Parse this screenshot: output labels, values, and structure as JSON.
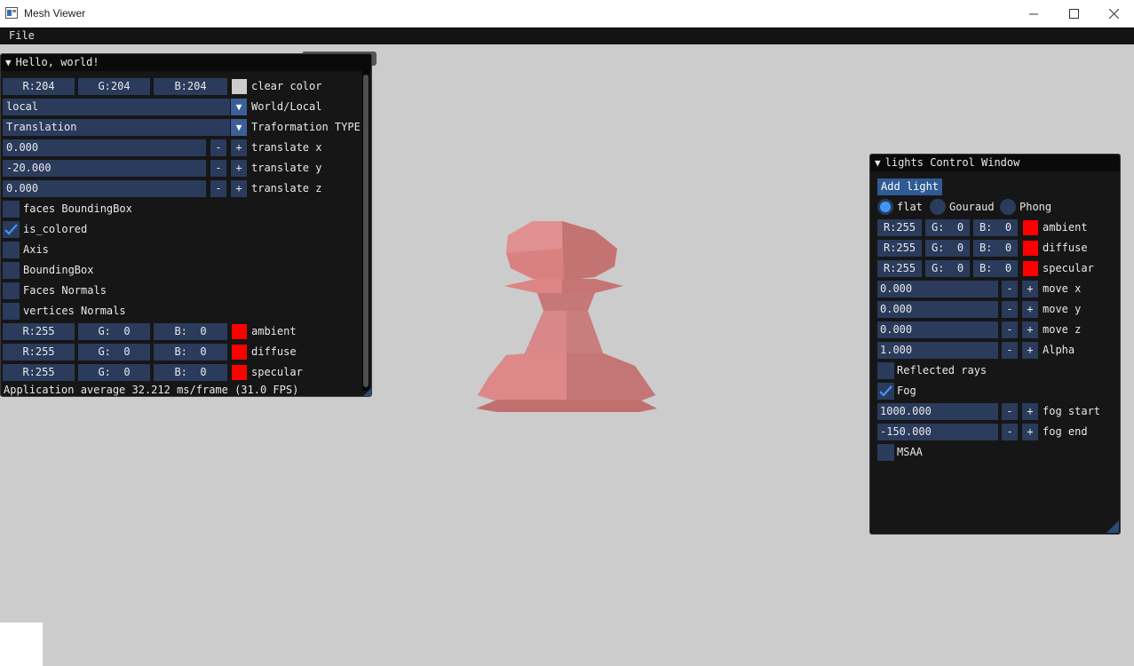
{
  "app": {
    "title": "Mesh Viewer"
  },
  "menubar": {
    "file": "File"
  },
  "hello_window": {
    "title": "Hello, world!",
    "clear_color": {
      "r": "R:204",
      "g": "G:204",
      "b": "B:204",
      "label": "clear color",
      "swatch": "#cccccc"
    },
    "space_select": {
      "value": "local",
      "label": "World/Local"
    },
    "transform_select": {
      "value": "Translation",
      "label": "Traformation TYPE"
    },
    "translate_x": {
      "value": "0.000",
      "label": "translate x"
    },
    "translate_y": {
      "value": "-20.000",
      "label": "translate y"
    },
    "translate_z": {
      "value": "0.000",
      "label": "translate z"
    },
    "minus": "-",
    "plus": "+",
    "checkboxes": [
      {
        "label": "faces BoundingBox",
        "checked": false
      },
      {
        "label": "is_colored",
        "checked": true
      },
      {
        "label": "Axis",
        "checked": false
      },
      {
        "label": "BoundingBox",
        "checked": false
      },
      {
        "label": "Faces Normals",
        "checked": false
      },
      {
        "label": "vertices Normals",
        "checked": false
      }
    ],
    "ambient": {
      "r": "R:255",
      "g": "G:  0",
      "b": "B:  0",
      "label": "ambient",
      "swatch": "#ff0000"
    },
    "diffuse": {
      "r": "R:255",
      "g": "G:  0",
      "b": "B:  0",
      "label": "diffuse",
      "swatch": "#ff0000"
    },
    "specular": {
      "r": "R:255",
      "g": "G:  0",
      "b": "B:  0",
      "label": "specular",
      "swatch": "#ff0000"
    },
    "fps": "Application average 32.212 ms/frame (31.0 FPS)"
  },
  "lights_window": {
    "title": "lights Control Window",
    "add_light": "Add light",
    "shading": [
      {
        "label": "flat",
        "selected": true
      },
      {
        "label": "Gouraud",
        "selected": false
      },
      {
        "label": "Phong",
        "selected": false
      }
    ],
    "ambient": {
      "r": "R:255",
      "g": "G:  0",
      "b": "B:  0",
      "label": "ambient",
      "swatch": "#ff0000"
    },
    "diffuse": {
      "r": "R:255",
      "g": "G:  0",
      "b": "B:  0",
      "label": "diffuse",
      "swatch": "#ff0000"
    },
    "specular": {
      "r": "R:255",
      "g": "G:  0",
      "b": "B:  0",
      "label": "specular",
      "swatch": "#ff0000"
    },
    "move_x": {
      "value": "0.000",
      "label": "move x"
    },
    "move_y": {
      "value": "0.000",
      "label": "move y"
    },
    "move_z": {
      "value": "0.000",
      "label": "move z"
    },
    "alpha": {
      "value": "1.000",
      "label": "Alpha"
    },
    "reflected_rays": {
      "label": "Reflected rays",
      "checked": false
    },
    "fog": {
      "label": "Fog",
      "checked": true
    },
    "fog_start": {
      "value": "1000.000",
      "label": "fog start"
    },
    "fog_end": {
      "value": "-150.000",
      "label": "fog end"
    },
    "msaa": {
      "label": "MSAA",
      "checked": false
    }
  },
  "colors": {
    "viewport_bg": "#cccccc",
    "accent": "#4296fa",
    "mesh": "#d97c7c"
  }
}
